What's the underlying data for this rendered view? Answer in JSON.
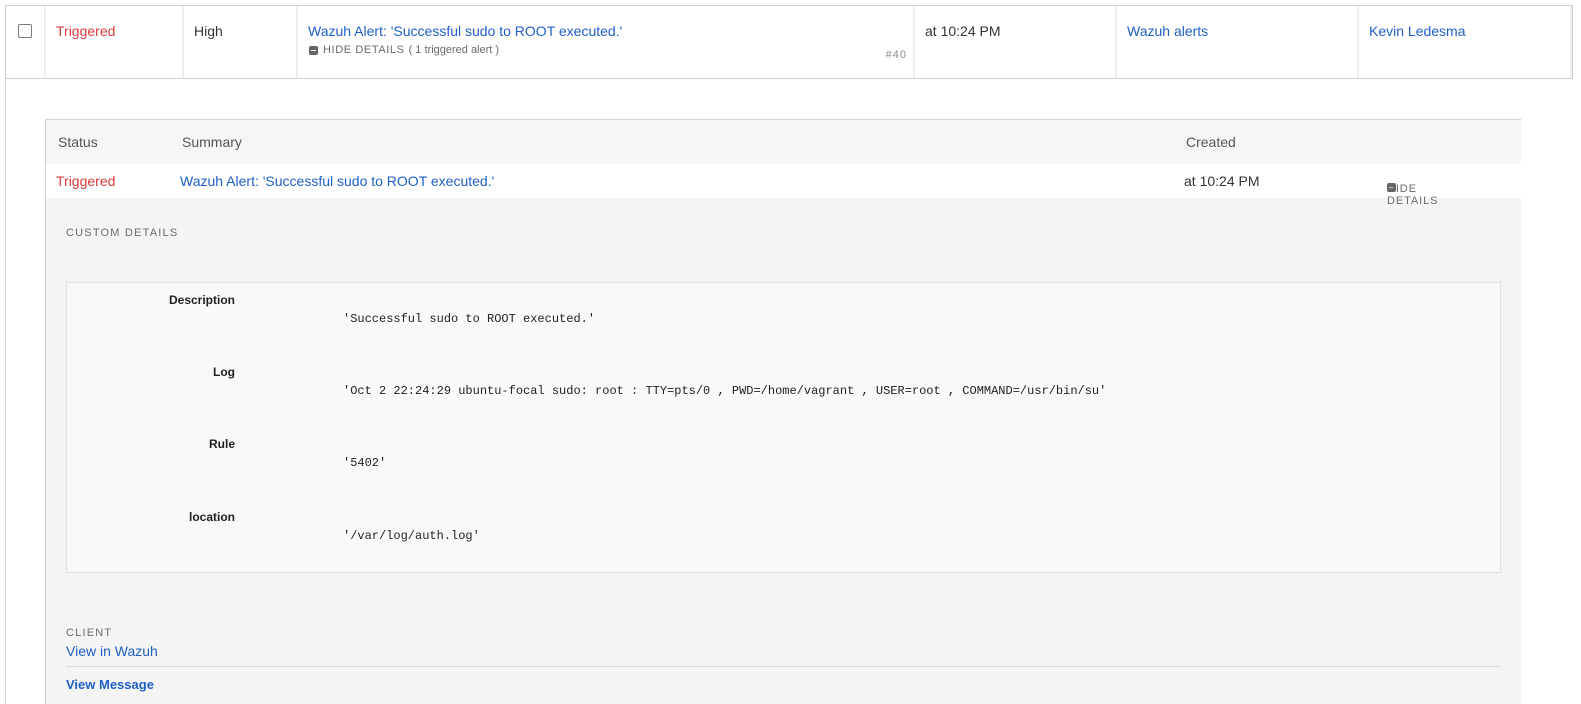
{
  "incident": {
    "status": "Triggered",
    "urgency": "High",
    "title": "Wazuh Alert: 'Successful sudo to ROOT executed.'",
    "hide_details_label": "HIDE DETAILS",
    "triggered_alerts": "( 1 triggered alert )",
    "number": "#40",
    "created": "at 10:24 PM",
    "service": "Wazuh alerts",
    "assignee": "Kevin Ledesma"
  },
  "alerts_table": {
    "headers": {
      "status": "Status",
      "summary": "Summary",
      "created": "Created"
    },
    "row": {
      "status": "Triggered",
      "summary": "Wazuh Alert: 'Successful sudo to ROOT executed.'",
      "created": "at 10:24 PM",
      "hide_details_label": "HIDE DETAILS"
    }
  },
  "custom_details": {
    "section_label": "CUSTOM DETAILS",
    "items": [
      {
        "key": "Description",
        "value": "'Successful sudo to ROOT executed.'"
      },
      {
        "key": "Log",
        "value": "'Oct 2 22:24:29 ubuntu-focal sudo: root : TTY=pts/0 , PWD=/home/vagrant , USER=root , COMMAND=/usr/bin/su'"
      },
      {
        "key": "Rule",
        "value": "'5402'"
      },
      {
        "key": "location",
        "value": "'/var/log/auth.log'"
      }
    ]
  },
  "client": {
    "section_label": "CLIENT",
    "link_label": "View in Wazuh",
    "view_message_label": "View Message"
  },
  "colors": {
    "triggered": "#d93a3a",
    "link": "#1f5fc8",
    "panel_bg": "#f4f4f4"
  }
}
